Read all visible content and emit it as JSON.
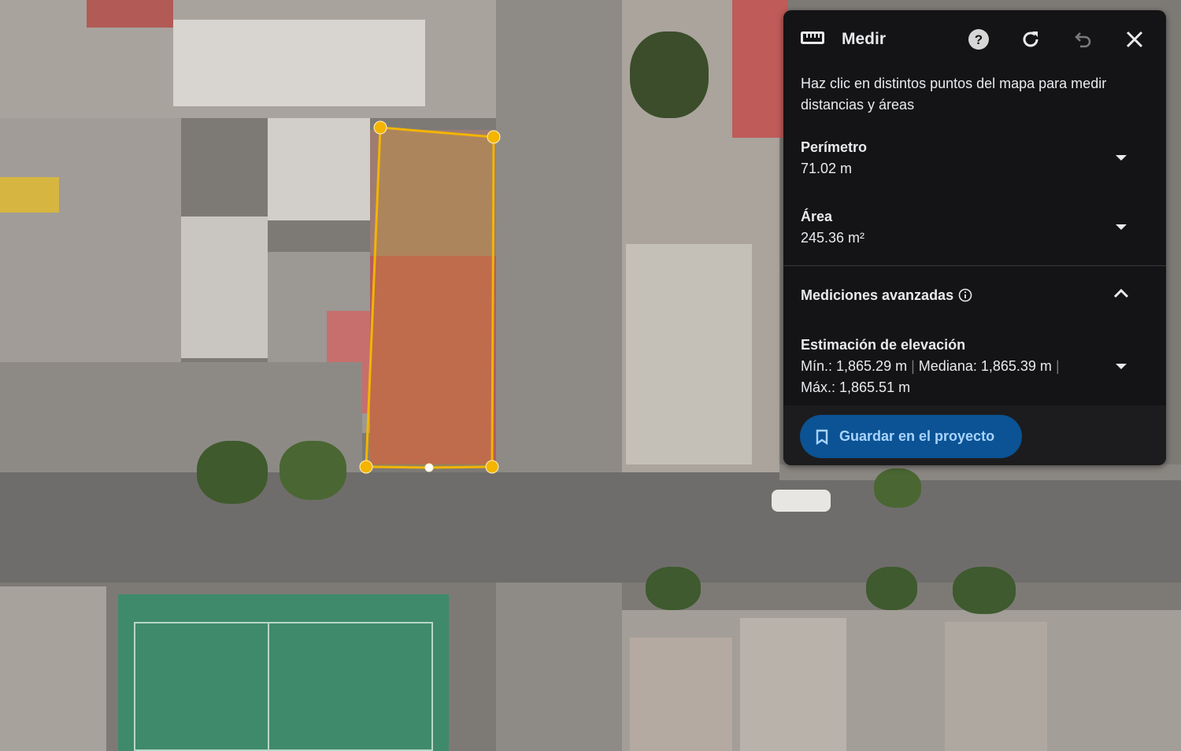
{
  "panel": {
    "title": "Medir",
    "description": "Haz clic en distintos puntos del mapa para medir distancias y áreas",
    "perimeter": {
      "label": "Perímetro",
      "value": "71.02 m"
    },
    "area": {
      "label": "Área",
      "value": "245.36 m²"
    },
    "advanced": {
      "label": "Mediciones avanzadas"
    },
    "elevation": {
      "label": "Estimación de elevación",
      "min": "Mín.: 1,865.29 m",
      "median": "Mediana: 1,865.39 m",
      "max": "Máx.: 1,865.51 m",
      "separator": "|"
    },
    "save_label": "Guardar en el proyecto"
  },
  "colors": {
    "measure_line": "#f4b400",
    "save_bg": "#0b5394",
    "panel_bg": "#141416"
  }
}
